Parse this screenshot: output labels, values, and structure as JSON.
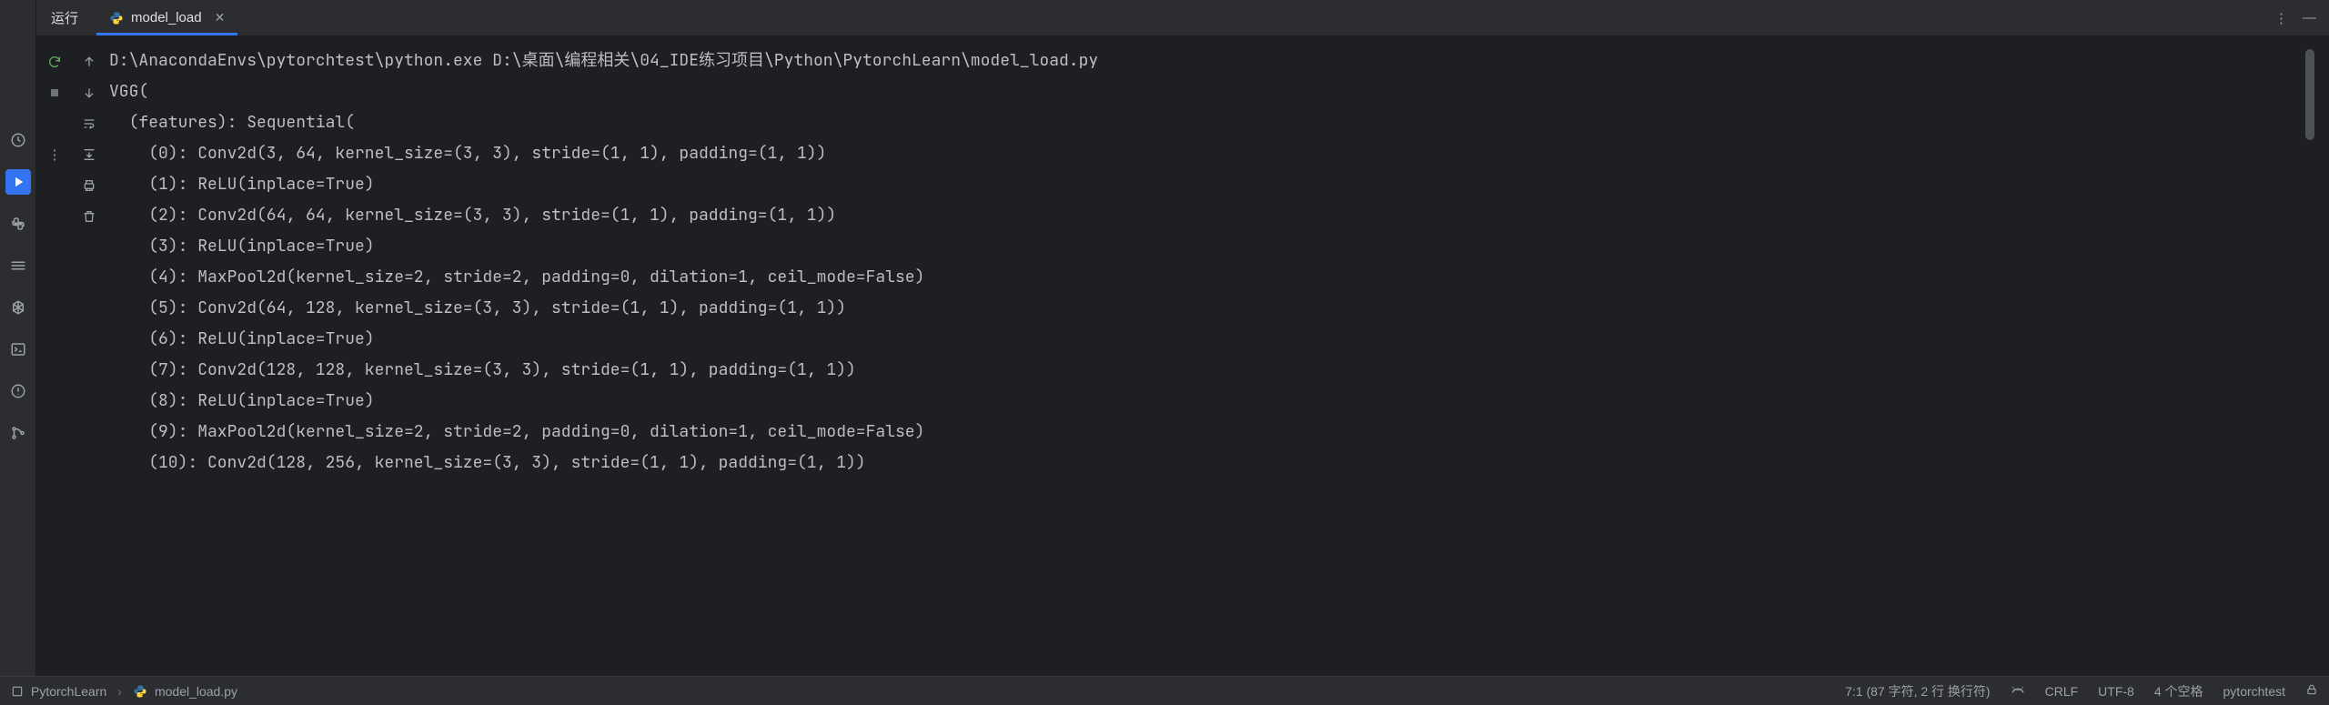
{
  "tool_window": {
    "title": "运行",
    "tab_label": "model_load"
  },
  "console_lines": [
    "D:\\AnacondaEnvs\\pytorchtest\\python.exe D:\\桌面\\编程相关\\04_IDE练习项目\\Python\\PytorchLearn\\model_load.py",
    "VGG(",
    "  (features): Sequential(",
    "    (0): Conv2d(3, 64, kernel_size=(3, 3), stride=(1, 1), padding=(1, 1))",
    "    (1): ReLU(inplace=True)",
    "    (2): Conv2d(64, 64, kernel_size=(3, 3), stride=(1, 1), padding=(1, 1))",
    "    (3): ReLU(inplace=True)",
    "    (4): MaxPool2d(kernel_size=2, stride=2, padding=0, dilation=1, ceil_mode=False)",
    "    (5): Conv2d(64, 128, kernel_size=(3, 3), stride=(1, 1), padding=(1, 1))",
    "    (6): ReLU(inplace=True)",
    "    (7): Conv2d(128, 128, kernel_size=(3, 3), stride=(1, 1), padding=(1, 1))",
    "    (8): ReLU(inplace=True)",
    "    (9): MaxPool2d(kernel_size=2, stride=2, padding=0, dilation=1, ceil_mode=False)",
    "    (10): Conv2d(128, 256, kernel_size=(3, 3), stride=(1, 1), padding=(1, 1))"
  ],
  "breadcrumbs": {
    "project": "PytorchLearn",
    "file": "model_load.py"
  },
  "status": {
    "caret": "7:1 (87 字符, 2 行 换行符)",
    "line_sep": "CRLF",
    "encoding": "UTF-8",
    "indent": "4 个空格",
    "interpreter": "pytorchtest"
  }
}
